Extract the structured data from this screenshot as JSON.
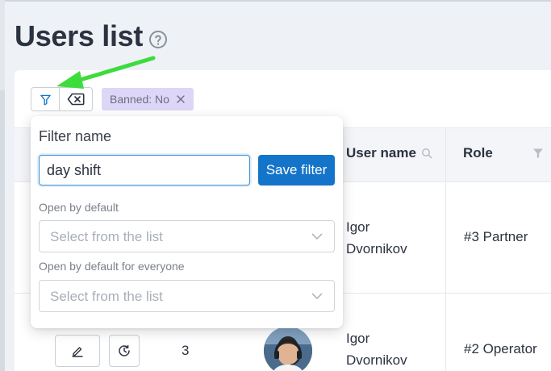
{
  "page": {
    "title": "Users list",
    "help_icon": "question-circle-icon"
  },
  "toolbar": {
    "filter_icon": "funnel-icon",
    "clear_icon": "backspace-x-icon"
  },
  "active_filter_chip": {
    "label": "Banned: No",
    "remove_icon": "close-icon"
  },
  "filter_popover": {
    "title": "Filter name",
    "name_value": "day shift",
    "save_label": "Save filter",
    "open_default_label": "Open by default",
    "open_default_placeholder": "Select from the list",
    "open_everyone_label": "Open by default for everyone",
    "open_everyone_placeholder": "Select from the list"
  },
  "table": {
    "columns": {
      "user_name": "User name",
      "role": "Role"
    },
    "rows": [
      {
        "user_first": "Igor",
        "user_last": "Dvornikov",
        "role": "#3 Partner"
      },
      {
        "id": "3",
        "user_first": "Igor",
        "user_last": "Dvornikov",
        "role": "#2 Operator"
      }
    ]
  },
  "colors": {
    "accent": "#1474c9",
    "chip_bg": "#ddd6f7",
    "arrow": "#3ddc3d"
  }
}
